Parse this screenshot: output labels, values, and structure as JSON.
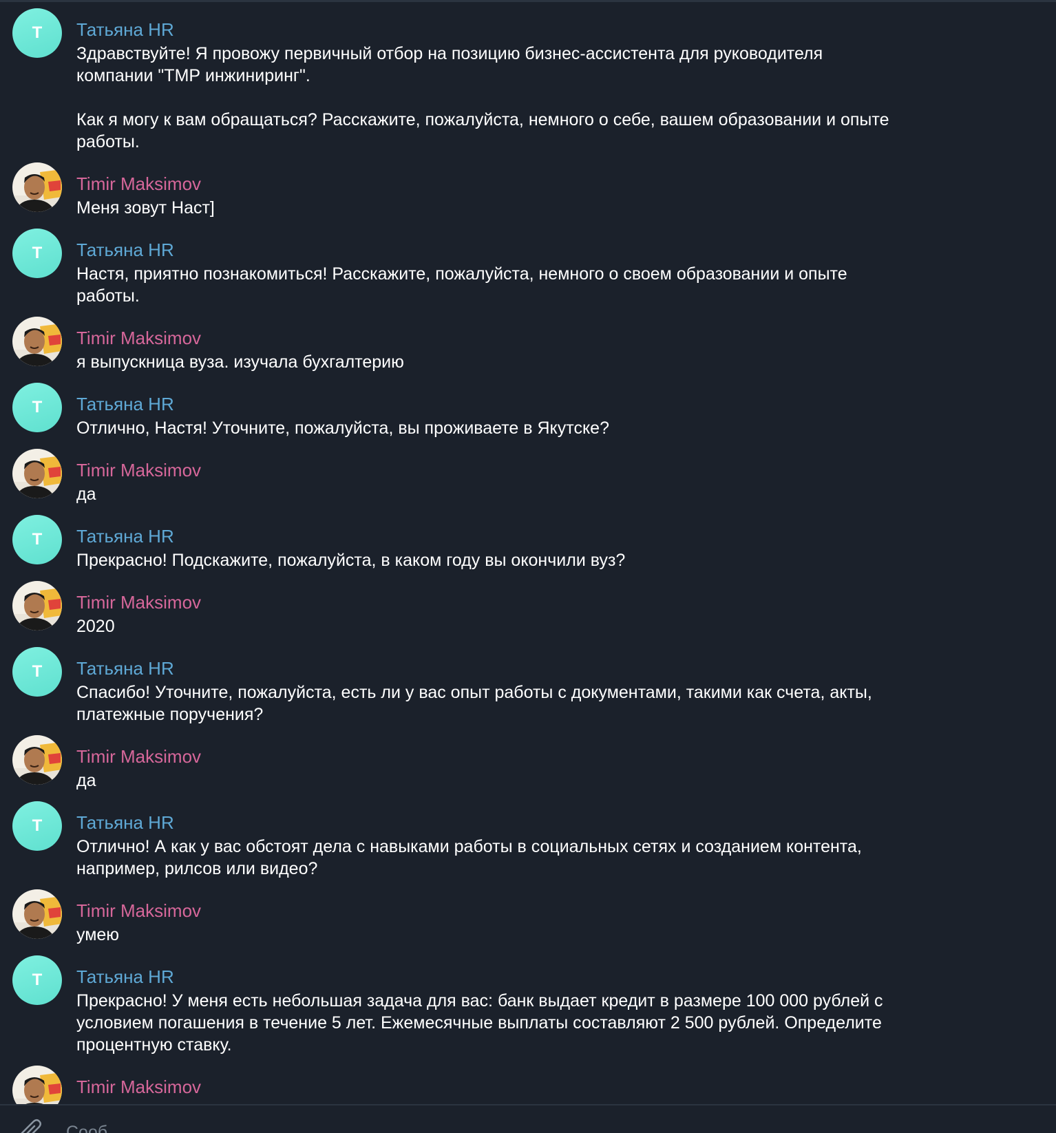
{
  "messages": [
    {
      "sender": "Татьяна HR",
      "role": "hr",
      "avatar_letter": "T",
      "text": "Здравствуйте! Я провожу первичный отбор на позицию бизнес-ассистента для руководителя\nкомпании \"ТМР инжиниринг\".\n\nКак я могу к вам обращаться? Расскажите, пожалуйста, немного о себе, вашем образовании и опыте\nработы."
    },
    {
      "sender": "Timir Maksimov",
      "role": "user",
      "text": "Меня зовут Наст]"
    },
    {
      "sender": "Татьяна HR",
      "role": "hr",
      "avatar_letter": "T",
      "text": "Настя, приятно познакомиться! Расскажите, пожалуйста, немного о своем образовании и опыте\nработы."
    },
    {
      "sender": "Timir Maksimov",
      "role": "user",
      "text": "я выпускница вуза. изучала бухгалтерию"
    },
    {
      "sender": "Татьяна HR",
      "role": "hr",
      "avatar_letter": "T",
      "text": "Отлично, Настя! Уточните, пожалуйста, вы проживаете в Якутске?"
    },
    {
      "sender": "Timir Maksimov",
      "role": "user",
      "text": "да"
    },
    {
      "sender": "Татьяна HR",
      "role": "hr",
      "avatar_letter": "T",
      "text": "Прекрасно! Подскажите, пожалуйста, в каком году вы окончили вуз?"
    },
    {
      "sender": "Timir Maksimov",
      "role": "user",
      "text": "2020"
    },
    {
      "sender": "Татьяна HR",
      "role": "hr",
      "avatar_letter": "T",
      "text": "Спасибо! Уточните, пожалуйста, есть ли у вас опыт работы с документами, такими как счета, акты,\nплатежные поручения?"
    },
    {
      "sender": "Timir Maksimov",
      "role": "user",
      "text": "да"
    },
    {
      "sender": "Татьяна HR",
      "role": "hr",
      "avatar_letter": "T",
      "text": "Отлично! А как у вас обстоят дела с навыками работы в социальных сетях и созданием контента,\nнапример, рилсов или видео?"
    },
    {
      "sender": "Timir Maksimov",
      "role": "user",
      "text": "умею"
    },
    {
      "sender": "Татьяна HR",
      "role": "hr",
      "avatar_letter": "T",
      "text": "Прекрасно! У меня есть небольшая задача для вас: банк выдает кредит в размере 100 000 рублей с\nусловием погашения в течение 5 лет. Ежемесячные выплаты составляют 2 500 рублей. Определите\nпроцентную ставку."
    },
    {
      "sender": "Timir Maksimov",
      "role": "user",
      "text": ""
    }
  ],
  "composer": {
    "placeholder": "Сооб",
    "attach_icon": "paperclip-icon"
  },
  "colors": {
    "background": "#1b212b",
    "hr_name": "#5fa9d6",
    "user_name": "#d6679a",
    "hr_avatar": "#6fe8d8",
    "text": "#ffffff"
  }
}
